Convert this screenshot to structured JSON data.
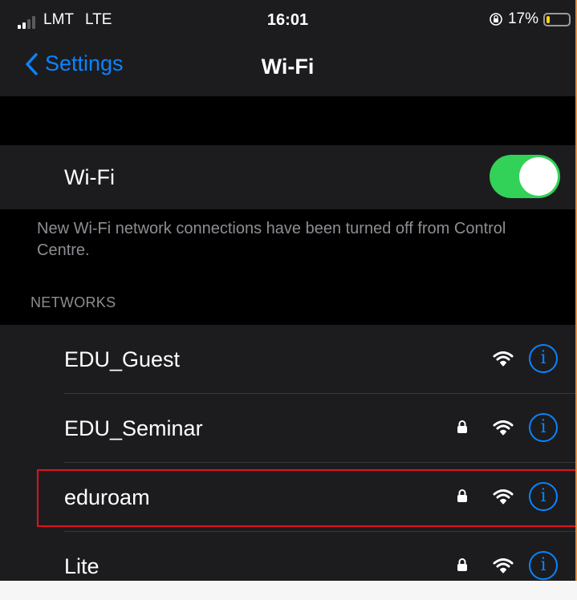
{
  "status_bar": {
    "carrier": "LMT",
    "network_type": "LTE",
    "time": "16:01",
    "battery_percent": "17%",
    "battery_level": 0.17,
    "signal_bars": 2
  },
  "nav": {
    "back_label": "Settings",
    "title": "Wi-Fi"
  },
  "wifi_toggle": {
    "label": "Wi-Fi",
    "on": true
  },
  "footnote": "New Wi-Fi network connections have been turned off from Control Centre.",
  "networks_header": "NETWORKS",
  "networks": [
    {
      "name": "EDU_Guest",
      "locked": false
    },
    {
      "name": "EDU_Seminar",
      "locked": true
    },
    {
      "name": "eduroam",
      "locked": true,
      "highlighted": true
    },
    {
      "name": "Lite",
      "locked": true
    }
  ],
  "colors": {
    "accent": "#0a84ff",
    "toggle_on": "#32d158",
    "highlight": "#e0121f",
    "battery": "#ffd60a"
  }
}
